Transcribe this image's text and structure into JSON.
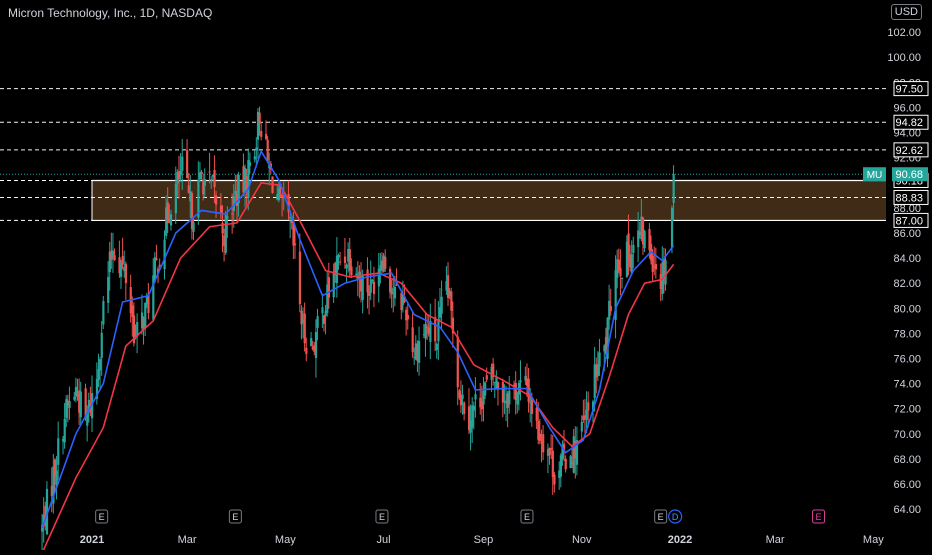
{
  "header": {
    "title": "Micron Technology, Inc., 1D, NASDAQ",
    "currency": "USD"
  },
  "colors": {
    "background": "#000000",
    "up": "#26a69a",
    "down": "#ef5350",
    "ema_fast": "#2962ff",
    "ema_slow": "#f23645",
    "zone_fill": "#4a331a",
    "axis_text": "#d1d4dc"
  },
  "chart_data": {
    "type": "candlestick",
    "symbol_tag": "MU",
    "last_price": 90.68,
    "ylim": [
      62.5,
      104
    ],
    "y_ticks": [
      64,
      66,
      68,
      70,
      72,
      74,
      76,
      78,
      80,
      82,
      84,
      86,
      88,
      90,
      92,
      94,
      96,
      98,
      100,
      102
    ],
    "x_labels": [
      "2021",
      "Mar",
      "May",
      "Jul",
      "Sep",
      "Nov",
      "2022",
      "Mar",
      "May"
    ],
    "levels": [
      {
        "value": 97.5,
        "label": "97.50",
        "style": "dashed"
      },
      {
        "value": 94.82,
        "label": "94.82",
        "style": "dashed"
      },
      {
        "value": 92.62,
        "label": "92.62",
        "style": "dashed"
      },
      {
        "value": 90.18,
        "label": "90.18",
        "style": "zone-top"
      },
      {
        "value": 88.83,
        "label": "88.83",
        "style": "dashed"
      },
      {
        "value": 87.0,
        "label": "87.00",
        "style": "zone-bottom"
      }
    ],
    "zone": {
      "from": 87.0,
      "to": 90.18,
      "start": "2021-01-01"
    },
    "earnings": [
      {
        "date": "2021-01-07",
        "label": "E"
      },
      {
        "date": "2021-03-31",
        "label": "E"
      },
      {
        "date": "2021-06-30",
        "label": "E"
      },
      {
        "date": "2021-09-28",
        "label": "E"
      },
      {
        "date": "2021-12-20",
        "label": "E"
      },
      {
        "date": "2022-03-28",
        "label": "E"
      }
    ],
    "dividend": {
      "date": "2021-12-29",
      "label": "D"
    },
    "price_anchors": [
      [
        "2020-12-01",
        62.5
      ],
      [
        "2020-12-10",
        68.0
      ],
      [
        "2020-12-15",
        71.5
      ],
      [
        "2020-12-22",
        73.5
      ],
      [
        "2020-12-28",
        71.0
      ],
      [
        "2021-01-04",
        74.5
      ],
      [
        "2021-01-08",
        80.0
      ],
      [
        "2021-01-14",
        85.0
      ],
      [
        "2021-01-22",
        82.5
      ],
      [
        "2021-01-28",
        77.5
      ],
      [
        "2021-02-05",
        80.5
      ],
      [
        "2021-02-12",
        84.5
      ],
      [
        "2021-02-19",
        88.5
      ],
      [
        "2021-02-26",
        91.0
      ],
      [
        "2021-03-04",
        87.5
      ],
      [
        "2021-03-10",
        90.5
      ],
      [
        "2021-03-17",
        89.5
      ],
      [
        "2021-03-24",
        86.0
      ],
      [
        "2021-03-31",
        89.0
      ],
      [
        "2021-04-06",
        90.0
      ],
      [
        "2021-04-12",
        93.0
      ],
      [
        "2021-04-15",
        95.5
      ],
      [
        "2021-04-20",
        91.5
      ],
      [
        "2021-04-27",
        88.5
      ],
      [
        "2021-05-04",
        86.5
      ],
      [
        "2021-05-07",
        84.0
      ],
      [
        "2021-05-12",
        78.0
      ],
      [
        "2021-05-18",
        77.0
      ],
      [
        "2021-05-25",
        80.0
      ],
      [
        "2021-06-02",
        83.5
      ],
      [
        "2021-06-09",
        84.5
      ],
      [
        "2021-06-16",
        82.5
      ],
      [
        "2021-06-23",
        81.5
      ],
      [
        "2021-06-30",
        84.5
      ],
      [
        "2021-07-08",
        81.0
      ],
      [
        "2021-07-14",
        80.5
      ],
      [
        "2021-07-20",
        76.5
      ],
      [
        "2021-07-27",
        78.5
      ],
      [
        "2021-08-03",
        77.5
      ],
      [
        "2021-08-09",
        82.0
      ],
      [
        "2021-08-13",
        78.5
      ],
      [
        "2021-08-17",
        73.5
      ],
      [
        "2021-08-23",
        71.5
      ],
      [
        "2021-08-30",
        73.0
      ],
      [
        "2021-09-07",
        74.5
      ],
      [
        "2021-09-14",
        73.0
      ],
      [
        "2021-09-21",
        73.5
      ],
      [
        "2021-09-28",
        73.8
      ],
      [
        "2021-10-04",
        70.5
      ],
      [
        "2021-10-11",
        69.0
      ],
      [
        "2021-10-15",
        67.0
      ],
      [
        "2021-10-21",
        68.0
      ],
      [
        "2021-10-28",
        69.0
      ],
      [
        "2021-11-05",
        71.5
      ],
      [
        "2021-11-10",
        75.0
      ],
      [
        "2021-11-16",
        77.0
      ],
      [
        "2021-11-22",
        84.0
      ],
      [
        "2021-11-26",
        83.5
      ],
      [
        "2021-12-01",
        84.5
      ],
      [
        "2021-12-08",
        86.0
      ],
      [
        "2021-12-14",
        84.5
      ],
      [
        "2021-12-20",
        82.5
      ],
      [
        "2021-12-22",
        83.5
      ],
      [
        "2021-12-23",
        84.2
      ]
    ],
    "final_candle": {
      "date": "2021-12-28",
      "open": 88.4,
      "high": 91.4,
      "low": 87.0,
      "close": 90.68
    },
    "gap_candle": {
      "date": "2021-12-27",
      "open": 84.8,
      "high": 88.2,
      "low": 84.4,
      "close": 88.0
    },
    "ema_fast": [
      [
        "2020-12-01",
        62.5
      ],
      [
        "2020-12-22",
        70.0
      ],
      [
        "2021-01-08",
        74.0
      ],
      [
        "2021-01-20",
        80.5
      ],
      [
        "2021-02-05",
        81.0
      ],
      [
        "2021-02-22",
        86.0
      ],
      [
        "2021-03-10",
        87.8
      ],
      [
        "2021-03-25",
        87.5
      ],
      [
        "2021-04-08",
        89.5
      ],
      [
        "2021-04-16",
        92.5
      ],
      [
        "2021-04-27",
        90.2
      ],
      [
        "2021-05-10",
        85.5
      ],
      [
        "2021-05-24",
        81.0
      ],
      [
        "2021-06-07",
        82.0
      ],
      [
        "2021-06-21",
        82.5
      ],
      [
        "2021-07-06",
        82.8
      ],
      [
        "2021-07-20",
        79.5
      ],
      [
        "2021-08-05",
        78.5
      ],
      [
        "2021-08-16",
        76.5
      ],
      [
        "2021-08-27",
        73.5
      ],
      [
        "2021-09-13",
        73.6
      ],
      [
        "2021-09-28",
        73.6
      ],
      [
        "2021-10-12",
        70.5
      ],
      [
        "2021-10-22",
        68.5
      ],
      [
        "2021-11-02",
        69.5
      ],
      [
        "2021-11-12",
        73.5
      ],
      [
        "2021-11-22",
        80.0
      ],
      [
        "2021-12-03",
        83.0
      ],
      [
        "2021-12-14",
        84.5
      ],
      [
        "2021-12-21",
        83.8
      ],
      [
        "2021-12-28",
        85.0
      ]
    ],
    "ema_slow": [
      [
        "2020-12-01",
        60.5
      ],
      [
        "2020-12-22",
        66.5
      ],
      [
        "2021-01-08",
        70.5
      ],
      [
        "2021-01-22",
        77.0
      ],
      [
        "2021-02-08",
        79.0
      ],
      [
        "2021-02-25",
        84.0
      ],
      [
        "2021-03-15",
        86.5
      ],
      [
        "2021-04-01",
        86.8
      ],
      [
        "2021-04-16",
        90.0
      ],
      [
        "2021-04-28",
        89.8
      ],
      [
        "2021-05-12",
        86.5
      ],
      [
        "2021-05-26",
        83.0
      ],
      [
        "2021-06-10",
        82.5
      ],
      [
        "2021-06-28",
        82.8
      ],
      [
        "2021-07-12",
        82.0
      ],
      [
        "2021-07-28",
        79.5
      ],
      [
        "2021-08-12",
        78.5
      ],
      [
        "2021-08-26",
        75.5
      ],
      [
        "2021-09-14",
        74.2
      ],
      [
        "2021-09-30",
        73.0
      ],
      [
        "2021-10-14",
        70.5
      ],
      [
        "2021-10-26",
        69.0
      ],
      [
        "2021-11-06",
        70.0
      ],
      [
        "2021-11-18",
        74.5
      ],
      [
        "2021-11-30",
        79.5
      ],
      [
        "2021-12-10",
        82.0
      ],
      [
        "2021-12-21",
        82.3
      ],
      [
        "2021-12-28",
        83.5
      ]
    ]
  }
}
